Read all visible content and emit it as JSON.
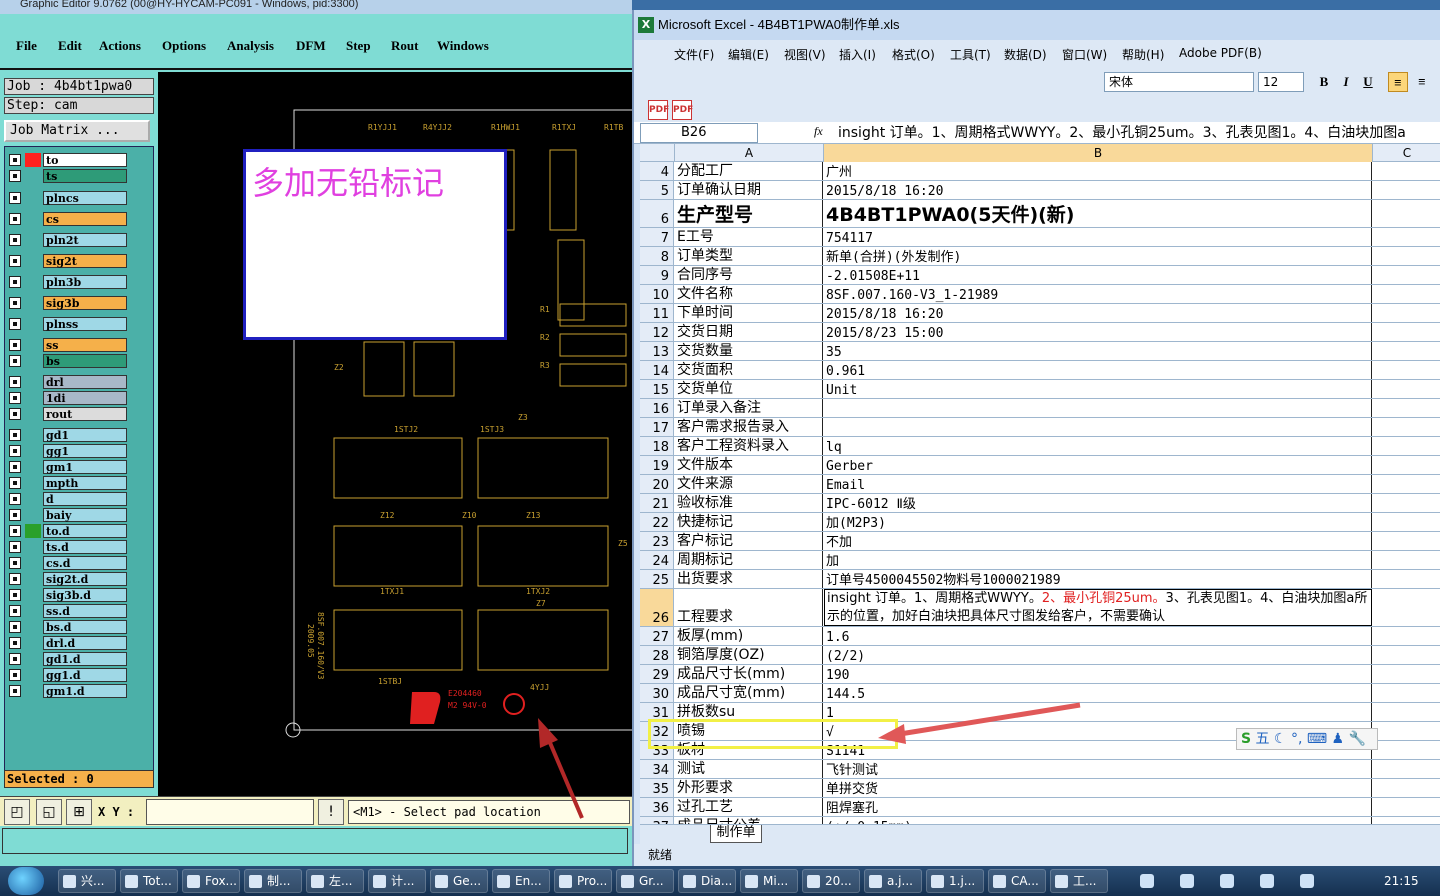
{
  "genesis": {
    "title": "Graphic Editor 9.0762 (00@HY-HYCAM-PC091 - Windows, pid:3300)",
    "menu": [
      "File",
      "Edit",
      "Actions",
      "Options",
      "Analysis",
      "DFM",
      "Step",
      "Rout",
      "Windows"
    ],
    "job": "Job : 4b4bt1pwa0",
    "step": "Step: cam",
    "job_matrix": "Job Matrix ...",
    "layers": [
      {
        "name": "to",
        "color": "#ffffff"
      },
      {
        "name": "ts",
        "color": "#2e9b78"
      },
      {
        "name": "plncs",
        "color": "#9fd8e6"
      },
      {
        "name": "cs",
        "color": "#f5b04a"
      },
      {
        "name": "pln2t",
        "color": "#9fd8e6"
      },
      {
        "name": "sig2t",
        "color": "#f5b04a"
      },
      {
        "name": "pln3b",
        "color": "#9fd8e6"
      },
      {
        "name": "sig3b",
        "color": "#f5b04a"
      },
      {
        "name": "plnss",
        "color": "#9fd8e6"
      },
      {
        "name": "ss",
        "color": "#f5b04a"
      },
      {
        "name": "bs",
        "color": "#2e9b78"
      },
      {
        "name": "drl",
        "color": "#a8b8c8"
      },
      {
        "name": "1di",
        "color": "#a8b8c8"
      },
      {
        "name": "rout",
        "color": "#dcdcdc"
      },
      {
        "name": "gd1",
        "color": "#9fd8e6"
      },
      {
        "name": "gg1",
        "color": "#9fd8e6"
      },
      {
        "name": "gm1",
        "color": "#9fd8e6"
      },
      {
        "name": "mpth",
        "color": "#9fd8e6"
      },
      {
        "name": "d",
        "color": "#9fd8e6"
      },
      {
        "name": "baiy",
        "color": "#9fd8e6"
      },
      {
        "name": "to.d",
        "color": "#9fd8e6"
      },
      {
        "name": "ts.d",
        "color": "#9fd8e6"
      },
      {
        "name": "cs.d",
        "color": "#9fd8e6"
      },
      {
        "name": "sig2t.d",
        "color": "#9fd8e6"
      },
      {
        "name": "sig3b.d",
        "color": "#9fd8e6"
      },
      {
        "name": "ss.d",
        "color": "#9fd8e6"
      },
      {
        "name": "bs.d",
        "color": "#9fd8e6"
      },
      {
        "name": "drl.d",
        "color": "#9fd8e6"
      },
      {
        "name": "gd1.d",
        "color": "#9fd8e6"
      },
      {
        "name": "gg1.d",
        "color": "#9fd8e6"
      },
      {
        "name": "gm1.d",
        "color": "#9fd8e6"
      }
    ],
    "selected": "Selected : 0",
    "xy_label": "X Y :",
    "status_message": "<M1> - Select pad location",
    "note_text": "多加无铅标记",
    "board_labels": [
      "R1YJJ1",
      "R4YJJ2",
      "R1HWJ1",
      "R1TXJ",
      "R1TB",
      "R1",
      "R2",
      "R3",
      "Z2",
      "Z3",
      "1STJ2",
      "1STJ3",
      "Z12",
      "Z10",
      "Z13",
      "Z5",
      "1TXJ1",
      "1TXJ2",
      "Z7",
      "1STBJ",
      "4YJJ",
      "8SF.007.160/V3",
      "2009.05",
      "E204460",
      "M2 94V-0"
    ]
  },
  "excel": {
    "title": "Microsoft Excel - 4B4BT1PWA0制作单.xls",
    "menu": [
      "文件(F)",
      "编辑(E)",
      "视图(V)",
      "插入(I)",
      "格式(O)",
      "工具(T)",
      "数据(D)",
      "窗口(W)",
      "帮助(H)",
      "Adobe PDF(B)"
    ],
    "font_name": "宋体",
    "font_size": "12",
    "name_box": "B26",
    "fx": "fx",
    "formula": "insight 订单。1、周期格式WWYY。2、最小孔铜25um。3、孔表见图1。4、白油块加图a",
    "columns": [
      "A",
      "B",
      "C"
    ],
    "rows": [
      {
        "n": "4",
        "a": "分配工厂",
        "b": "广州"
      },
      {
        "n": "5",
        "a": "订单确认日期",
        "b": "2015/8/18 16:20"
      },
      {
        "n": "6",
        "a": "生产型号",
        "b": "4B4BT1PWA0(5天件)(新)"
      },
      {
        "n": "7",
        "a": "E工号",
        "b": "754117"
      },
      {
        "n": "8",
        "a": "订单类型",
        "b": "新单(合拼)(外发制作)"
      },
      {
        "n": "9",
        "a": "合同序号",
        "b": "-2.01508E+11"
      },
      {
        "n": "10",
        "a": "文件名称",
        "b": "8SF.007.160-V3_1-21989"
      },
      {
        "n": "11",
        "a": "下单时间",
        "b": "2015/8/18 16:20"
      },
      {
        "n": "12",
        "a": "交货日期",
        "b": "2015/8/23 15:00"
      },
      {
        "n": "13",
        "a": "交货数量",
        "b": "35"
      },
      {
        "n": "14",
        "a": "交货面积",
        "b": "0.961"
      },
      {
        "n": "15",
        "a": "交货单位",
        "b": "Unit"
      },
      {
        "n": "16",
        "a": "订单录入备注",
        "b": ""
      },
      {
        "n": "17",
        "a": "客户需求报告录入",
        "b": ""
      },
      {
        "n": "18",
        "a": "客户工程资料录入",
        "b": "lq"
      },
      {
        "n": "19",
        "a": "文件版本",
        "b": "Gerber"
      },
      {
        "n": "20",
        "a": "文件来源",
        "b": "Email"
      },
      {
        "n": "21",
        "a": "验收标准",
        "b": "IPC-6012 Ⅱ级"
      },
      {
        "n": "22",
        "a": "快捷标记",
        "b": "加(M2P3)"
      },
      {
        "n": "23",
        "a": "客户标记",
        "b": "不加"
      },
      {
        "n": "24",
        "a": "周期标记",
        "b": "加"
      },
      {
        "n": "25",
        "a": "出货要求",
        "b": "订单号4500045502物料号1000021989"
      },
      {
        "n": "26",
        "a": "工程要求",
        "b": ""
      },
      {
        "n": "27",
        "a": "板厚(mm)",
        "b": "1.6"
      },
      {
        "n": "28",
        "a": "铜箔厚度(OZ)",
        "b": "(2/2)"
      },
      {
        "n": "29",
        "a": "成品尺寸长(mm)",
        "b": "190"
      },
      {
        "n": "30",
        "a": "成品尺寸宽(mm)",
        "b": "144.5"
      },
      {
        "n": "31",
        "a": "拼板数su",
        "b": "1"
      },
      {
        "n": "32",
        "a": "喷锡",
        "b": "√"
      },
      {
        "n": "33",
        "a": "板材",
        "b": "S1141"
      },
      {
        "n": "34",
        "a": "测试",
        "b": "飞针测试"
      },
      {
        "n": "35",
        "a": "外形要求",
        "b": "单拼交货"
      },
      {
        "n": "36",
        "a": "过孔工艺",
        "b": "阻焊塞孔"
      },
      {
        "n": "37",
        "a": "成品尺寸公差",
        "b": "(+/-0.15mm)"
      }
    ],
    "r26_part1": "insight 订单。1、周期格式WWYY。",
    "r26_red": "2、最小孔铜25um。",
    "r26_part2": "3、孔表见图1。4、白油块加图a所示的位置，加好白油块把具体尺寸图发给客户，不需要确认",
    "sheet_tab": "制作单",
    "status": "就绪",
    "ime_label": "五"
  },
  "taskbar": {
    "items": [
      "兴...",
      "Tot...",
      "Fox...",
      "制...",
      "左...",
      "计...",
      "Ge...",
      "En...",
      "Pro...",
      "Gr...",
      "Dia...",
      "Mi...",
      "20...",
      "a.j...",
      "1.j...",
      "CA...",
      "工..."
    ],
    "clock": "21:15"
  }
}
